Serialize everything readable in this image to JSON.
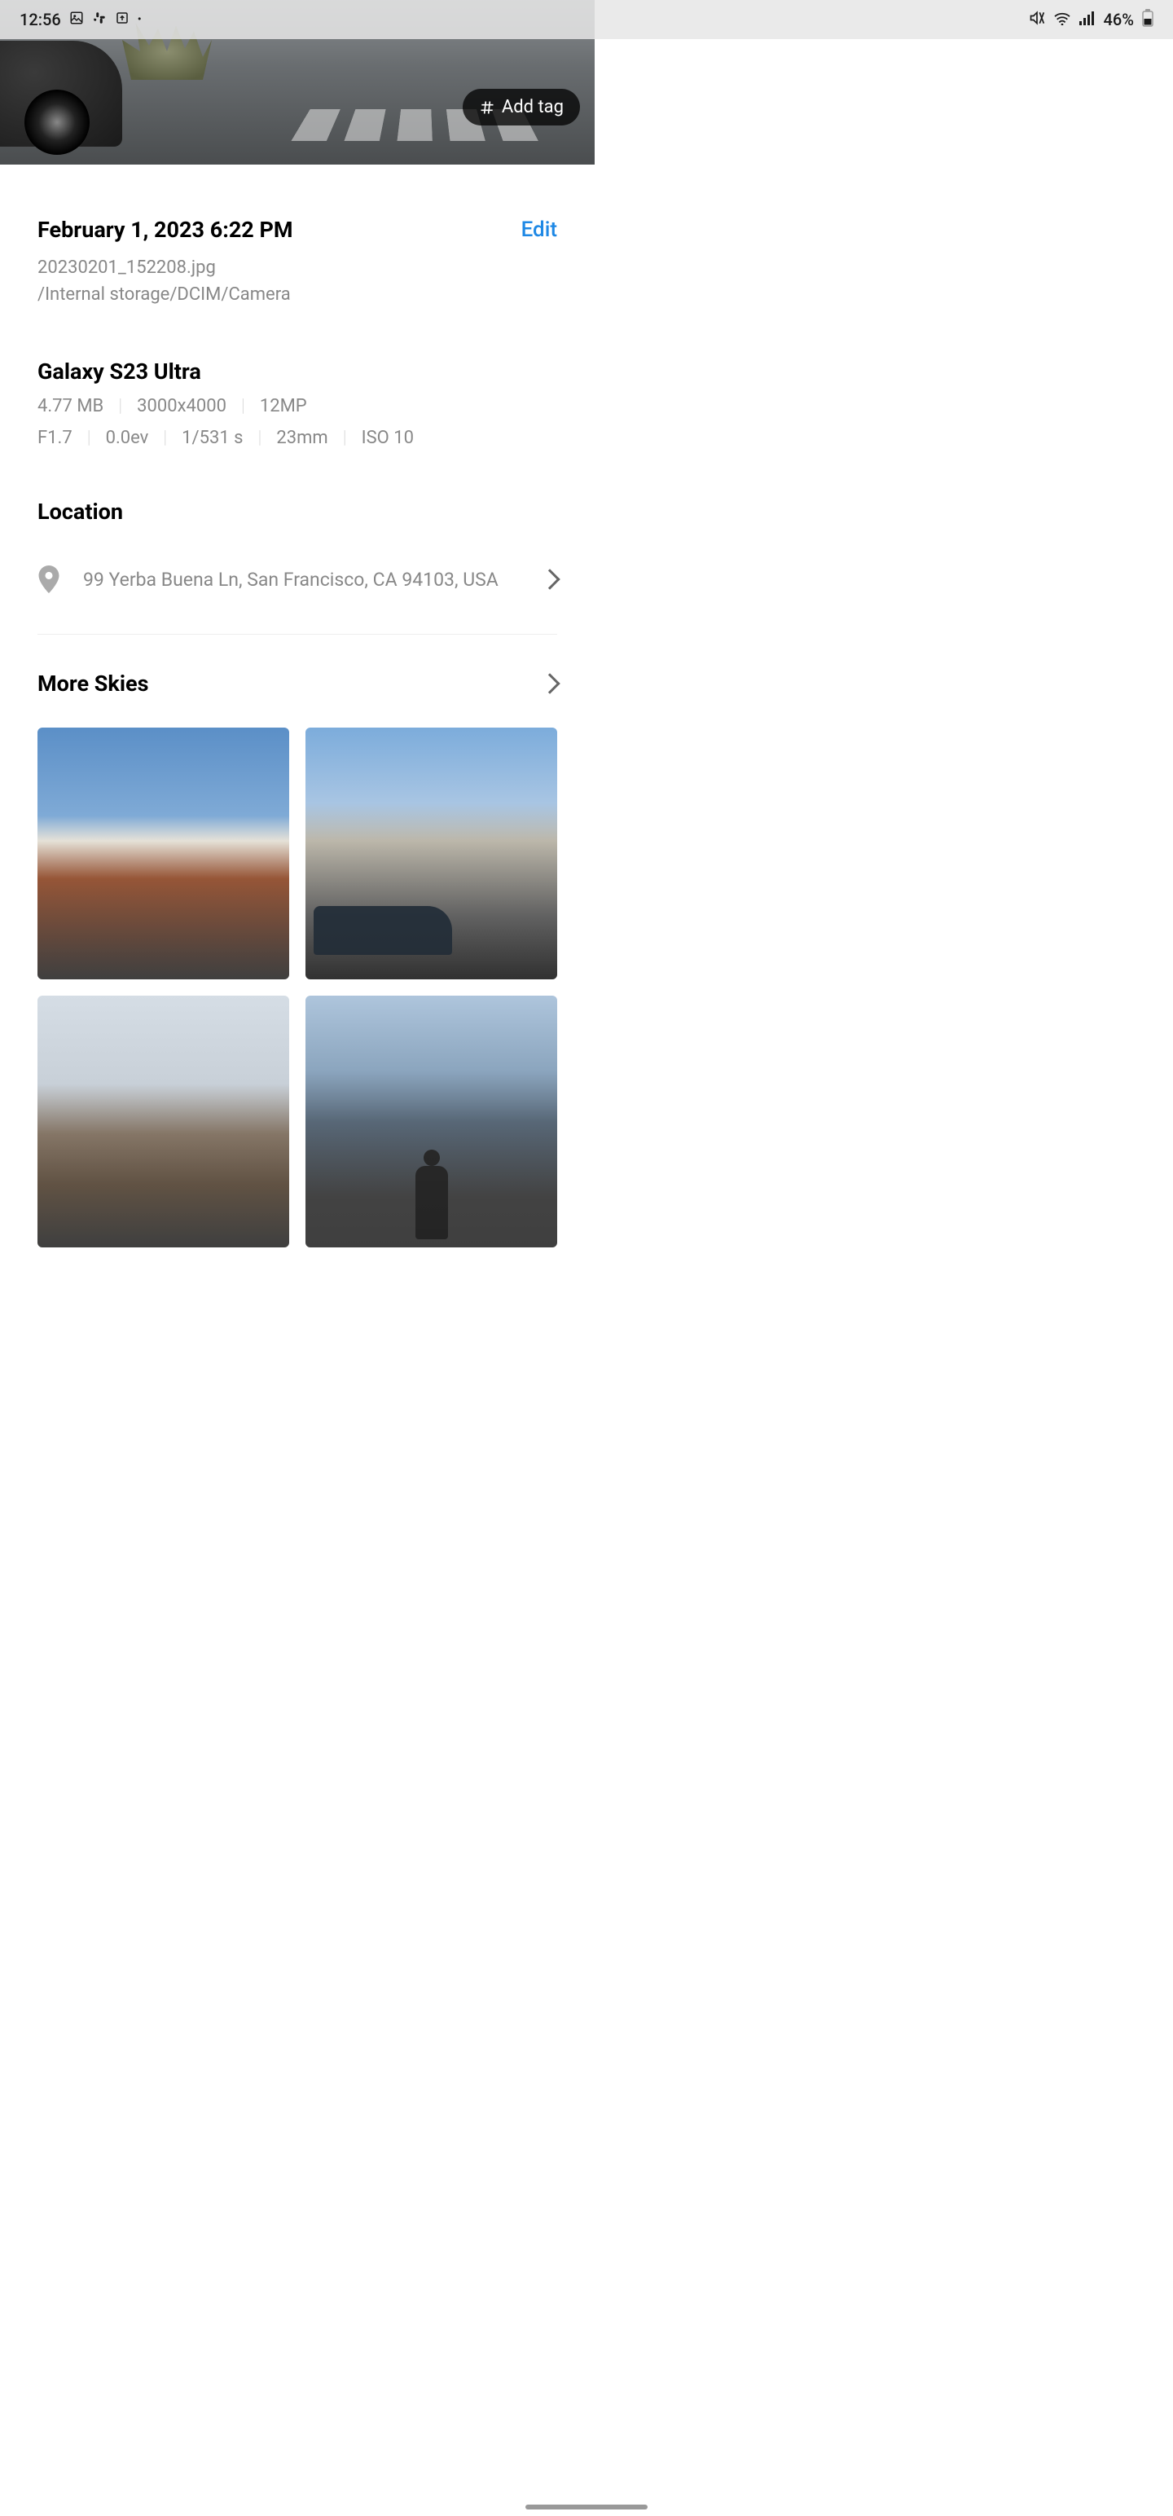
{
  "status": {
    "time": "12:56",
    "battery": "46%"
  },
  "hero": {
    "addTag": "Add tag"
  },
  "details": {
    "datetime": "February 1, 2023 6:22 PM",
    "editLabel": "Edit",
    "filename": "20230201_152208.jpg",
    "path": "/Internal storage/DCIM/Camera"
  },
  "device": {
    "name": "Galaxy S23 Ultra",
    "size": "4.77 MB",
    "resolution": "3000x4000",
    "megapixels": "12MP",
    "aperture": "F1.7",
    "ev": "0.0ev",
    "shutter": "1/531 s",
    "focal": "23mm",
    "iso": "ISO 10"
  },
  "location": {
    "title": "Location",
    "address": "99 Yerba Buena Ln, San Francisco, CA 94103, USA"
  },
  "more": {
    "title": "More Skies"
  }
}
